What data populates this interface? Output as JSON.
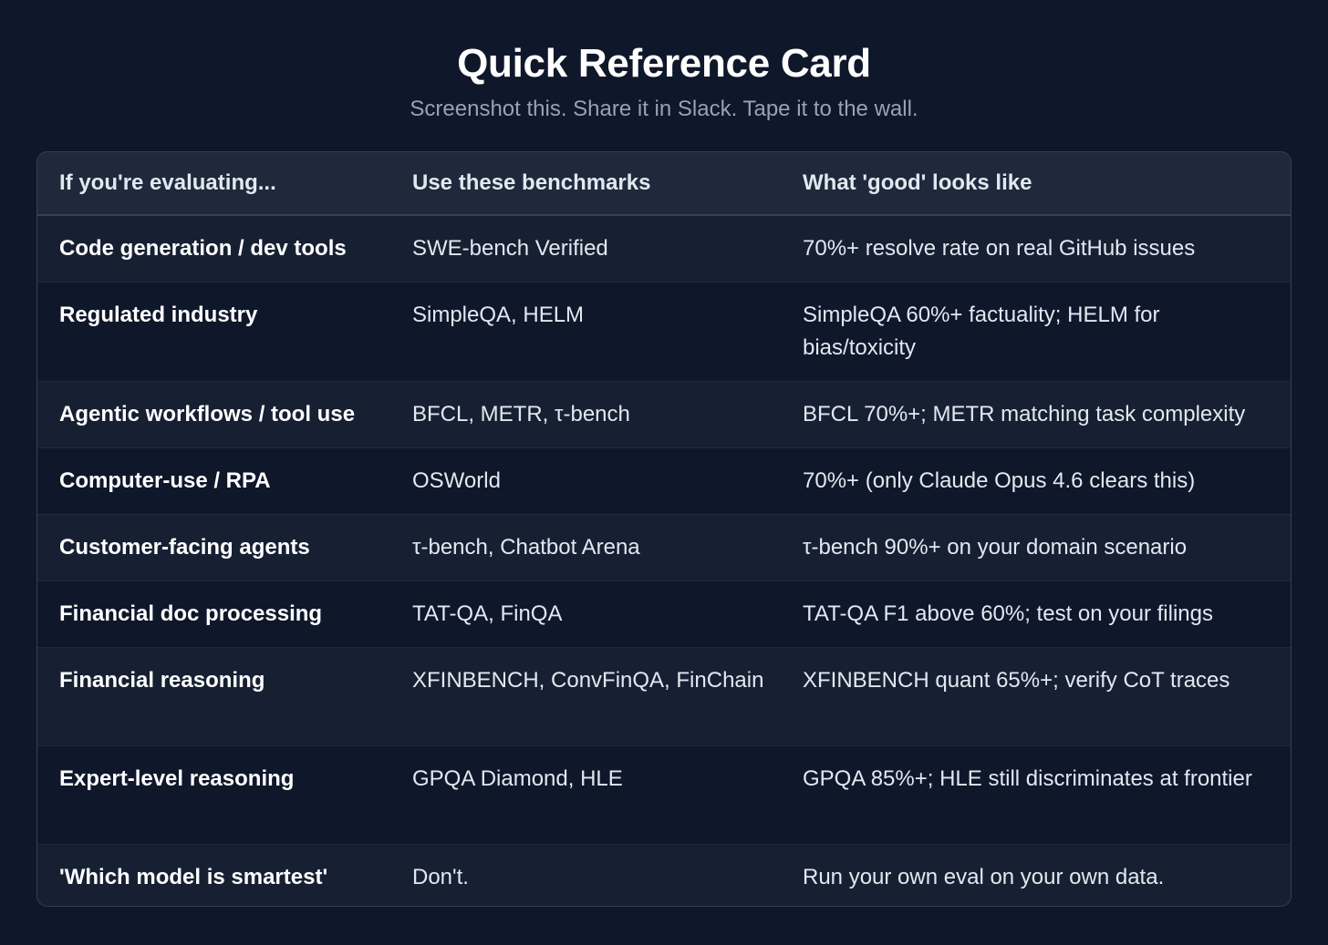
{
  "header": {
    "title": "Quick Reference Card",
    "subtitle": "Screenshot this. Share it in Slack. Tape it to the wall."
  },
  "table": {
    "columns": [
      "If you're evaluating...",
      "Use these benchmarks",
      "What 'good' looks like"
    ],
    "rows": [
      {
        "use_case": "Code generation / dev tools",
        "benchmarks": "SWE-bench Verified",
        "good": "70%+ resolve rate on real GitHub issues"
      },
      {
        "use_case": "Regulated industry",
        "benchmarks": "SimpleQA, HELM",
        "good": "SimpleQA 60%+ factuality; HELM for bias/toxicity"
      },
      {
        "use_case": "Agentic workflows / tool use",
        "benchmarks": "BFCL, METR, τ-bench",
        "good": "BFCL 70%+; METR matching task complexity"
      },
      {
        "use_case": "Computer-use / RPA",
        "benchmarks": "OSWorld",
        "good": "70%+ (only Claude Opus 4.6 clears this)"
      },
      {
        "use_case": "Customer-facing agents",
        "benchmarks": "τ-bench, Chatbot Arena",
        "good": "τ-bench 90%+ on your domain scenario"
      },
      {
        "use_case": "Financial doc processing",
        "benchmarks": "TAT-QA, FinQA",
        "good": "TAT-QA F1 above 60%; test on your filings"
      },
      {
        "use_case": "Financial reasoning",
        "benchmarks": "XFINBENCH, ConvFinQA, FinChain",
        "good": "XFINBENCH quant 65%+; verify CoT traces"
      },
      {
        "use_case": "Expert-level reasoning",
        "benchmarks": "GPQA Diamond, HLE",
        "good": "GPQA 85%+; HLE still discriminates at frontier"
      },
      {
        "use_case": "'Which model is smartest'",
        "benchmarks": "Don't.",
        "good": "Run your own eval on your own data."
      }
    ]
  },
  "colors": {
    "background": "#0f172a",
    "header_row": "#1e293b",
    "title": "#ffffff",
    "subtitle": "#94a3b8"
  }
}
